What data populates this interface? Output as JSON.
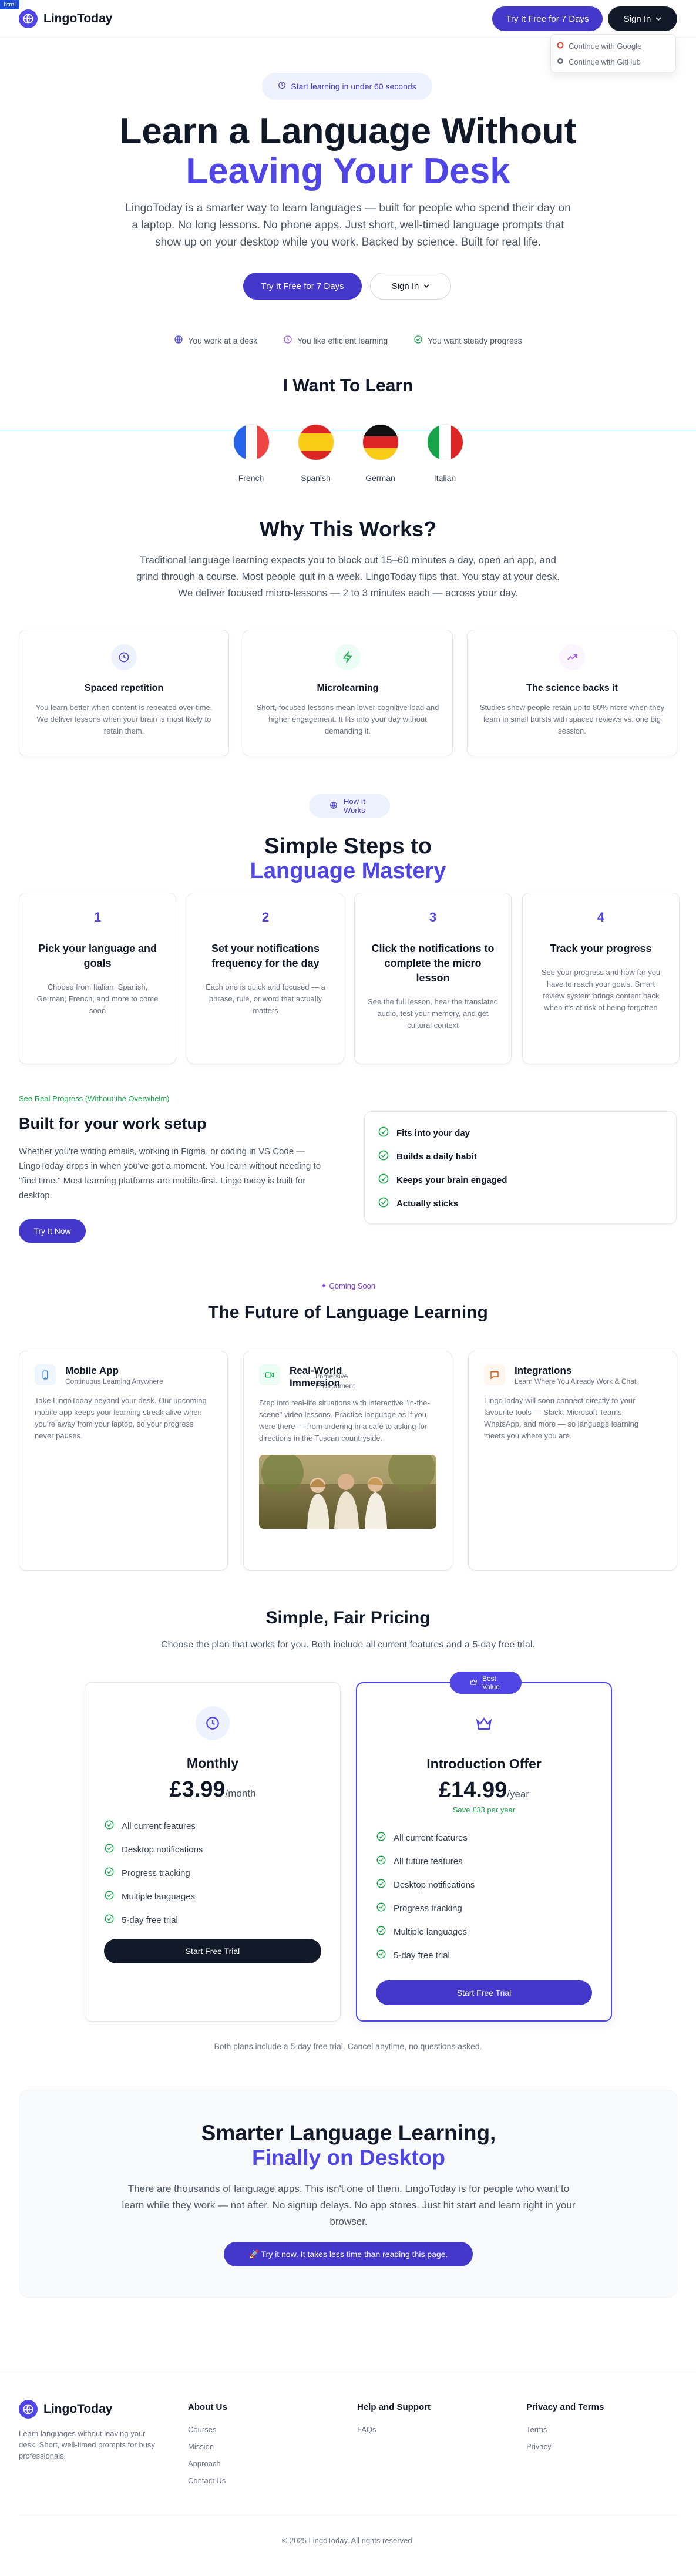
{
  "page_badge": "html",
  "header": {
    "logo_text": "LingoToday",
    "cta_label": "Try It Free for 7 Days",
    "signin_label": "Sign In",
    "signin_menu": [
      "Continue with Google",
      "Continue with GitHub"
    ]
  },
  "hero": {
    "pill": "Start learning in under 60 seconds",
    "title_line1": "Learn a Language Without",
    "title_line2": "Leaving Your Desk",
    "subtitle": "LingoToday is a smarter way to learn languages — built for people who spend their day on a laptop. No long lessons. No phone apps. Just short, well-timed language prompts that show up on your desktop while you work. Backed by science. Built for real life.",
    "primary_button": "Try It Free for 7 Days",
    "secondary_button": "Sign In",
    "checks": [
      "You work at a desk",
      "You like efficient learning",
      "You want steady progress"
    ]
  },
  "learn": {
    "title": "I Want To Learn",
    "languages": [
      "French",
      "Spanish",
      "German",
      "Italian"
    ]
  },
  "why": {
    "title": "Why This Works?",
    "subtitle": "Traditional language learning expects you to block out 15–60 minutes a day, open an app, and grind through a course. Most people quit in a week. LingoToday flips that. You stay at your desk. We deliver focused micro-lessons — 2 to 3 minutes each — across your day.",
    "cards": [
      {
        "title": "Spaced repetition",
        "body": "You learn better when content is repeated over time. We deliver lessons when your brain is most likely to retain them."
      },
      {
        "title": "Microlearning",
        "body": "Short, focused lessons mean lower cognitive load and higher engagement. It fits into your day without demanding it."
      },
      {
        "title": "The science backs it",
        "body": "Studies show people retain up to 80% more when they learn in small bursts with spaced reviews vs. one big session."
      }
    ]
  },
  "steps": {
    "pill": "How It Works",
    "title_line1": "Simple Steps to",
    "title_line2": "Language Mastery",
    "items": [
      {
        "num": "1",
        "title": "Pick your language and goals",
        "body": "Choose from Italian, Spanish, German, French, and more to come soon"
      },
      {
        "num": "2",
        "title": "Set your notifications frequency for the day",
        "body": "Each one is quick and focused — a phrase, rule, or word that actually matters"
      },
      {
        "num": "3",
        "title": "Click the notifications to complete the micro lesson",
        "body": "See the full lesson, hear the translated audio, test your memory, and get cultural context"
      },
      {
        "num": "4",
        "title": "Track your progress",
        "body": "See your progress and how far you have to reach your goals. Smart review system brings content back when it's at risk of being forgotten"
      }
    ]
  },
  "built": {
    "kicker": "See Real Progress (Without the Overwhelm)",
    "title": "Built for your work setup",
    "body": "Whether you're writing emails, working in Figma, or coding in VS Code — LingoToday drops in when you've got a moment. You learn without needing to \"find time.\" Most learning platforms are mobile-first. LingoToday is built for desktop.",
    "button": "Try It Now",
    "checklist": [
      "Fits into your day",
      "Builds a daily habit",
      "Keeps your brain engaged",
      "Actually sticks"
    ]
  },
  "future": {
    "pill": "Coming Soon",
    "title": "The Future of Language Learning",
    "cards": [
      {
        "title": "Mobile App",
        "subtitle": "Continuous Learning Anywhere",
        "body": "Take LingoToday beyond your desk. Our upcoming mobile app keeps your learning streak alive when you're away from your laptop, so your progress never pauses."
      },
      {
        "title": "Real-World Immersion",
        "subtitle": "Immersive Environment",
        "body": "Step into real-life situations with interactive \"in-the-scene\" video lessons. Practice language as if you were there — from ordering in a café to asking for directions in the Tuscan countryside."
      },
      {
        "title": "Integrations",
        "subtitle": "Learn Where You Already Work & Chat",
        "body": "LingoToday will soon connect directly to your favourite tools — Slack, Microsoft Teams, WhatsApp, and more — so language learning meets you where you are."
      }
    ]
  },
  "pricing": {
    "title": "Simple, Fair Pricing",
    "subtitle": "Choose the plan that works for you. Both include all current features and a 5-day free trial.",
    "best_badge": "Best Value",
    "plans": [
      {
        "name": "Monthly",
        "price": "£3.99",
        "period": "/month",
        "save": "",
        "features": [
          "All current features",
          "Desktop notifications",
          "Progress tracking",
          "Multiple languages",
          "5-day free trial"
        ],
        "button": "Start Free Trial"
      },
      {
        "name": "Introduction Offer",
        "price": "£14.99",
        "period": "/year",
        "save": "Save £33 per year",
        "features": [
          "All current features",
          "All future features",
          "Desktop notifications",
          "Progress tracking",
          "Multiple languages",
          "5-day free trial"
        ],
        "button": "Start Free Trial"
      }
    ],
    "note": "Both plans include a 5-day free trial. Cancel anytime, no questions asked."
  },
  "cta": {
    "title_line1": "Smarter Language Learning,",
    "title_line2": "Finally on Desktop",
    "body": "There are thousands of language apps. This isn't one of them. LingoToday is for people who want to learn while they work — not after. No signup delays. No app stores. Just hit start and learn right in your browser.",
    "button": "🚀 Try it now. It takes less time than reading this page."
  },
  "footer": {
    "logo_text": "LingoToday",
    "tagline": "Learn languages without leaving your desk. Short, well-timed prompts for busy professionals.",
    "columns": [
      {
        "title": "About Us",
        "links": [
          "Courses",
          "Mission",
          "Approach",
          "Contact Us"
        ]
      },
      {
        "title": "Help and Support",
        "links": [
          "FAQs"
        ]
      },
      {
        "title": "Privacy and Terms",
        "links": [
          "Terms",
          "Privacy"
        ]
      }
    ],
    "copyright": "© 2025 LingoToday. All rights reserved."
  },
  "colors": {
    "brand": "#4f46e5",
    "brand_dark": "#4338ca",
    "dark": "#111827",
    "green": "#16a34a",
    "purple": "#7c3aed"
  }
}
